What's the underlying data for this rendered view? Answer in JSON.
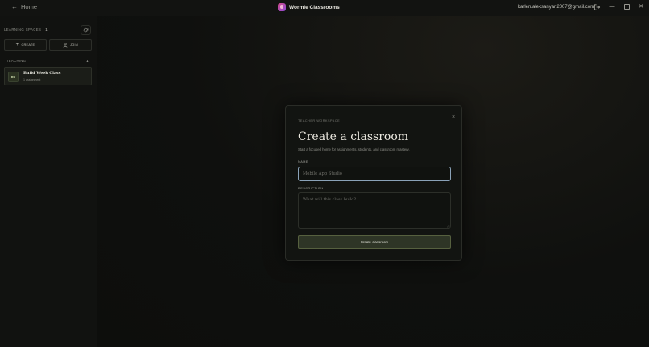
{
  "topbar": {
    "back_label": "Home",
    "app_name": "Wormie Classrooms",
    "email": "karlen.aleksanyan2007@gmail.com",
    "controls": [
      "minimize",
      "maximize",
      "close"
    ]
  },
  "sidebar": {
    "learning_spaces_label": "LEARNING SPACES",
    "learning_spaces_count": "1",
    "create_label": "CREATE",
    "join_label": "JOIN",
    "teaching_label": "TEACHING",
    "teaching_count": "1",
    "classes": [
      {
        "initials": "BU",
        "name": "Build Week Class",
        "assignments": "1 assignment"
      }
    ]
  },
  "modal": {
    "kicker": "TEACHER WORKSPACE",
    "title": "Create a classroom",
    "subtitle": "Start a focused home for assignments, students, and classroom mastery.",
    "name_label": "NAME",
    "name_placeholder": "Mobile App Studio",
    "name_value": "",
    "description_label": "DESCRIPTION",
    "description_placeholder": "What will this class build?",
    "submit_label": "Create classroom",
    "close_glyph": "×"
  },
  "colors": {
    "background": "#0e0f0d",
    "focus_ring": "#8aa2b8",
    "accent_button": "#2e3526",
    "brand_gradient_start": "#d04b8a",
    "brand_gradient_end": "#8f4bd6"
  }
}
